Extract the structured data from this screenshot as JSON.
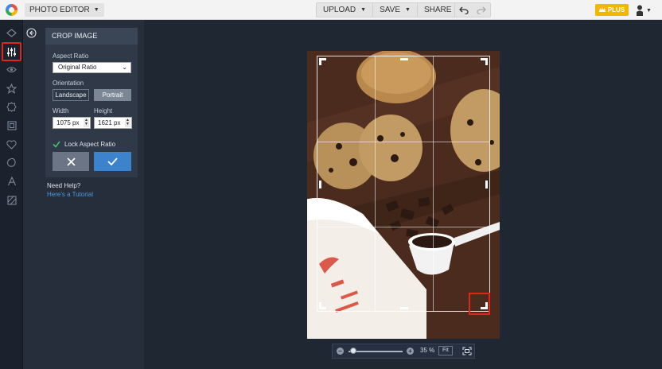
{
  "topbar": {
    "editor_label": "PHOTO EDITOR",
    "actions": [
      "UPLOAD",
      "SAVE",
      "SHARE"
    ],
    "plus_label": "PLUS"
  },
  "rail": {
    "icons": [
      "layers-icon",
      "adjust-sliders-icon",
      "eye-icon",
      "star-icon",
      "badge-icon",
      "frame-icon",
      "heart-icon",
      "blob-icon",
      "text-icon",
      "texture-icon"
    ],
    "active_index": 1,
    "highlight_color": "#e0251b"
  },
  "crop_panel": {
    "title": "CROP IMAGE",
    "aspect_ratio_label": "Aspect Ratio",
    "aspect_ratio_value": "Original Ratio",
    "orientation_label": "Orientation",
    "landscape_label": "Landscape",
    "portrait_label": "Portrait",
    "width_label": "Width",
    "width_value": "1075 px",
    "height_label": "Height",
    "height_value": "1621 px",
    "lock_label": "Lock Aspect Ratio",
    "lock_checked": true
  },
  "help": {
    "title": "Need Help?",
    "link": "Here's a Tutorial"
  },
  "zoom": {
    "value_label": "35 %",
    "fit_label": "Fit"
  },
  "colors": {
    "accent": "#3c82cd",
    "plus_badge": "#f3b700",
    "link": "#4b9be0"
  }
}
